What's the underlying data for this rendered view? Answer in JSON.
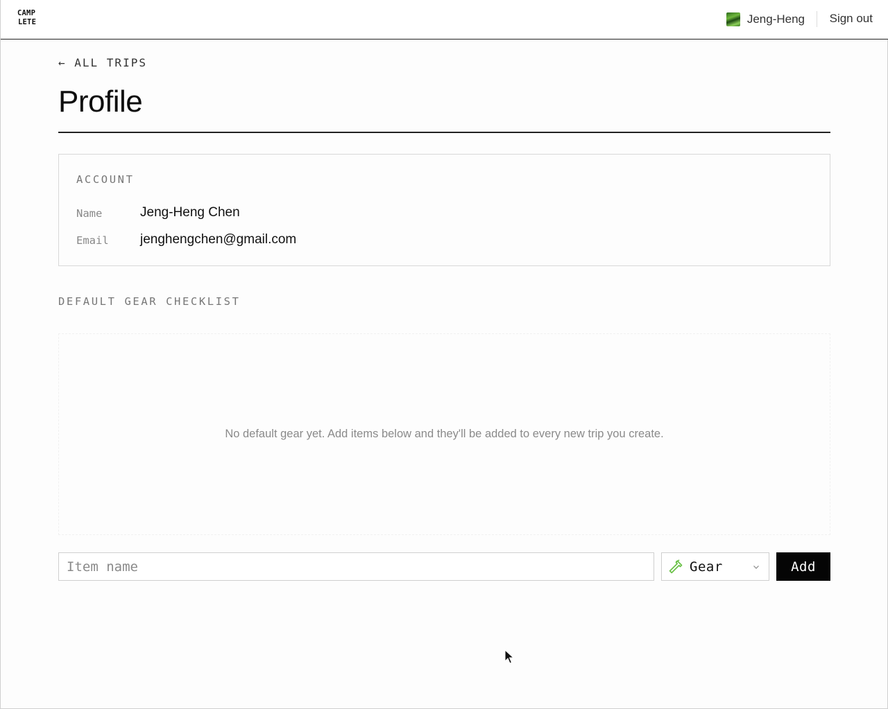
{
  "header": {
    "logo_line1": "CAMP",
    "logo_line2": "LETE",
    "user_name": "Jeng-Heng",
    "sign_out_label": "Sign out"
  },
  "breadcrumb": {
    "back_label": "← ALL TRIPS"
  },
  "page": {
    "title": "Profile"
  },
  "account": {
    "section_title": "ACCOUNT",
    "name_label": "Name",
    "name_value": "Jeng-Heng Chen",
    "email_label": "Email",
    "email_value": "jenghengchen@gmail.com"
  },
  "gear": {
    "section_title": "DEFAULT GEAR CHECKLIST",
    "empty_message": "No default gear yet. Add items below and they'll be added to every new trip you create.",
    "item_input_value": "",
    "item_input_placeholder": "Item name",
    "category_selected": "Gear",
    "category_icon": "hammer-icon",
    "add_label": "Add"
  },
  "colors": {
    "accent_dark": "#050505",
    "border": "#cfcfcf",
    "muted_text": "#8a8a8a",
    "icon_green": "#6cc24a"
  }
}
